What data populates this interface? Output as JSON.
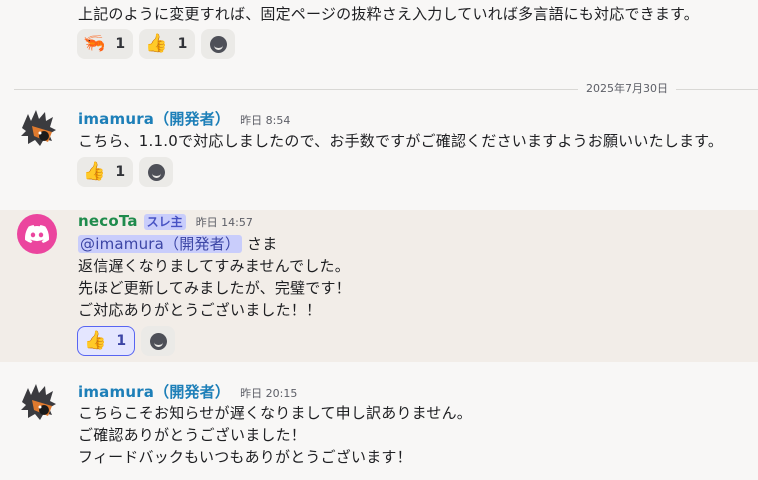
{
  "messages": [
    {
      "text_lines": [
        "上記のように変更すれば、固定ページの抜粋さえ入力していれば多言語にも対応できます。"
      ],
      "reactions": [
        {
          "emoji": "🦐",
          "icon": "shrimp-icon",
          "count": "1"
        },
        {
          "emoji": "👍",
          "icon": "thumbs-up-icon",
          "count": "1"
        }
      ]
    },
    {
      "username": "imamura（開発者）",
      "time": "昨日 8:54",
      "text_lines": [
        "こちら、1.1.0で対応しましたので、お手数ですがご確認くださいますようお願いいたします。"
      ],
      "reactions": [
        {
          "emoji": "👍",
          "icon": "thumbs-up-icon",
          "count": "1"
        }
      ]
    },
    {
      "username": "necoTa",
      "role_badge": "スレ主",
      "time": "昨日 14:57",
      "mention": "@imamura（開発者）",
      "mention_suffix": " さま",
      "text_lines": [
        "返信遅くなりましてすみませんでした。",
        "先ほど更新してみましたが、完璧です！",
        "ご対応ありがとうございました！！"
      ],
      "reactions": [
        {
          "emoji": "👍",
          "icon": "thumbs-up-icon",
          "count": "1",
          "active": true
        }
      ]
    },
    {
      "username": "imamura（開発者）",
      "time": "昨日 20:15",
      "text_lines": [
        "こちらこそお知らせが遅くなりまして申し訳ありません。",
        "ご確認ありがとうございました！",
        "フィードバックもいつもありがとうございます！"
      ]
    }
  ],
  "date_divider": "2025年7月30日",
  "colors": {
    "background": "#f8f7f6",
    "highlight": "#f2ede8",
    "username_blue": "#1d7fb8",
    "username_green": "#1f8b4c",
    "mention_bg": "#c9cdfb",
    "discord_pink": "#eb459e"
  }
}
